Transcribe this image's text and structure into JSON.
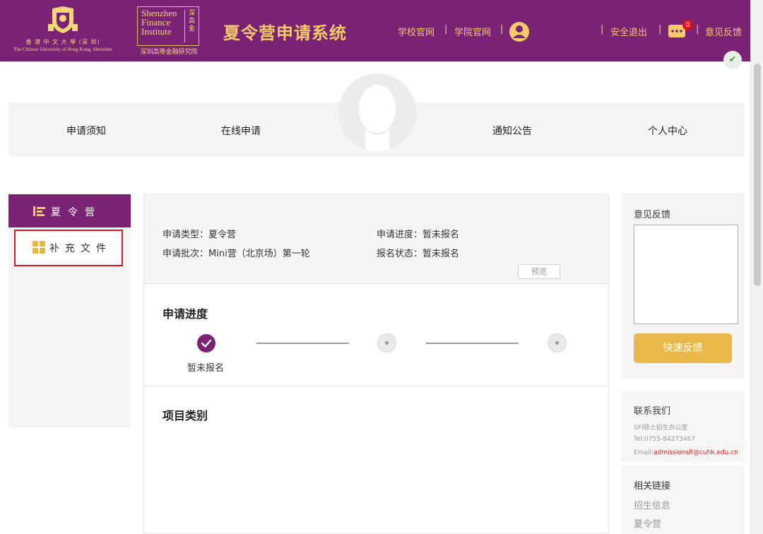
{
  "header": {
    "cuhk": {
      "cn": "香 港 中 文 大 學 (深 圳)",
      "en": "The Chinese University of Hong Kong, Shenzhen"
    },
    "sfi": {
      "line1": "Shenzhen",
      "line2": "Finance",
      "line3": "Institute",
      "seal": "深高金",
      "cn": "深圳高等金融研究院"
    },
    "title": "夏令营申请系统",
    "links": {
      "school": "学校官网",
      "college": "学院官网",
      "logout": "安全退出",
      "feedback": "意见反馈"
    },
    "message_count": "0",
    "colors": {
      "brand": "#7a2374",
      "gold": "#f3c96a"
    }
  },
  "nav": {
    "items": [
      "申请须知",
      "在线申请",
      "通知公告",
      "个人中心"
    ]
  },
  "sidebar": {
    "header": "夏令营",
    "item": "补充文件"
  },
  "info": {
    "type_label": "申请类型：",
    "type_value": "夏令营",
    "batch_label": "申请批次：",
    "batch_value": "Mini营（北京场）第一轮",
    "progress_label": "申请进度：",
    "progress_value": "暂未报名",
    "status_label": "报名状态：",
    "status_value": "暂未报名",
    "preview": "预览"
  },
  "progress": {
    "title": "申请进度",
    "step1_label": "暂未报名"
  },
  "category": {
    "title": "项目类别"
  },
  "feedback": {
    "title": "意见反馈",
    "button": "快速反馈"
  },
  "contact": {
    "title": "联系我们",
    "office": "SFI硕士招生办公室",
    "tel": "Tel:0755-84273467",
    "email_label": "Email:",
    "email": "admissionsfi@cuhk.edu.cn"
  },
  "links": {
    "title": "相关链接",
    "items": [
      "招生信息",
      "夏令营"
    ]
  },
  "icons": [
    "crest-icon",
    "user-icon",
    "message-icon",
    "check-icon",
    "menu-icon",
    "grid-icon"
  ]
}
